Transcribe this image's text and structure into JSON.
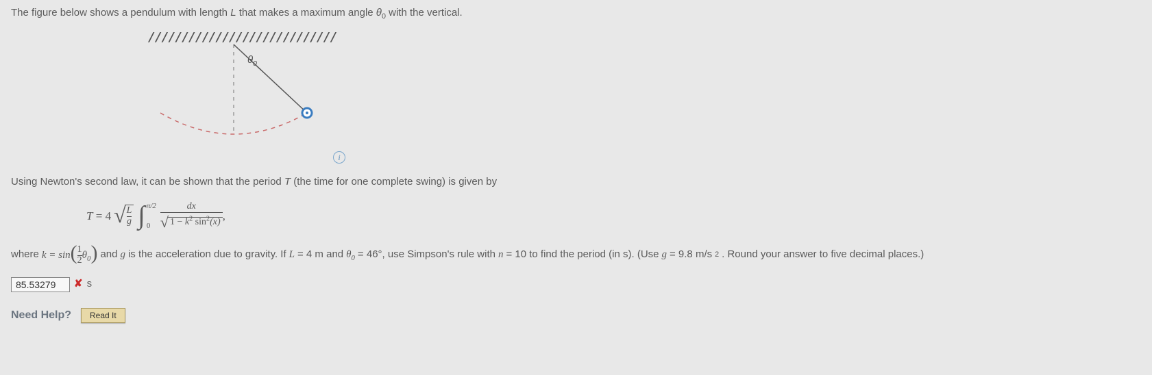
{
  "intro_prefix": "The figure below shows a pendulum with length ",
  "intro_L": "L",
  "intro_mid": " that makes a maximum angle ",
  "intro_theta": "θ",
  "intro_theta_sub": "0",
  "intro_suffix": " with the vertical.",
  "figure": {
    "hatching": "////////////////////////////",
    "theta": "θ",
    "theta_sub": "0"
  },
  "info_icon": "i",
  "desc_prefix": "Using Newton's second law, it can be shown that the period ",
  "desc_T": "T",
  "desc_suffix": " (the time for one complete swing) is given by",
  "formula": {
    "lhs_T": "T",
    "eq": " = ",
    "coef": "4",
    "frac_num": "L",
    "frac_den": "g",
    "int_upper": "π/2",
    "int_lower": "0",
    "integrand_num": "dx",
    "one_minus": "1 − ",
    "k": "k",
    "sq": "2",
    "sin": " sin",
    "x": "(x)",
    "comma": " ,"
  },
  "where": {
    "where": "where ",
    "k_eq": "k = sin",
    "half_num": "1",
    "half_den": "2",
    "theta": "θ",
    "theta_sub": "0",
    "and_g": " and ",
    "g": "g",
    "is_accel": " is the acceleration due to gravity. If ",
    "L": "L",
    "L_val": " = 4 m and ",
    "theta2": "θ",
    "theta2_sub": "0",
    "theta_val": " = 46°, use Simpson's rule with ",
    "n": "n",
    "n_val": " = 10 to find the period (in s). (Use ",
    "g2": "g",
    "g_val": " = 9.8 m/s",
    "g_sq": "2",
    "round": ". Round your answer to five decimal places.)"
  },
  "answer_value": "85.53279",
  "unit": "s",
  "help_label": "Need Help?",
  "read_button": "Read It"
}
